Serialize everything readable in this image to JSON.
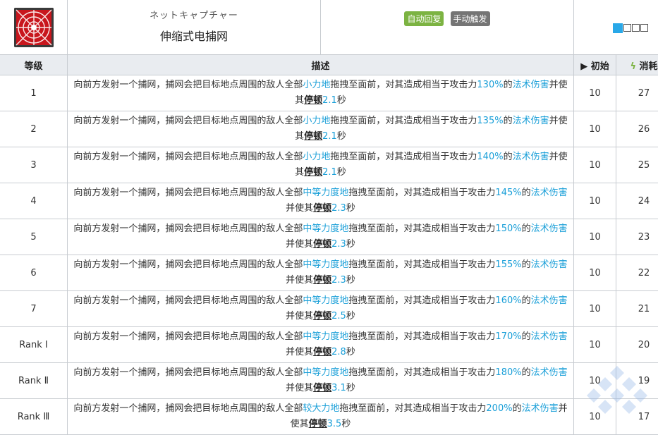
{
  "skill": {
    "name_jp": "ネットキャプチャー",
    "name_cn": "伸缩式电捕网",
    "tags": [
      "自动回复",
      "手动触发"
    ]
  },
  "headers": {
    "level": "等级",
    "description": "描述",
    "initial": "初始",
    "cost": "消耗"
  },
  "rows": [
    {
      "level": "1",
      "parts": [
        {
          "t": "向前方发射一个捕网，捕网会把目标地点周围的敌人全部"
        },
        {
          "t": "小力地",
          "c": "blue"
        },
        {
          "t": "拖拽至面前，对其造成相当于攻击力"
        },
        {
          "t": "130%",
          "c": "blue"
        },
        {
          "t": "的"
        },
        {
          "t": "法术伤害",
          "c": "blue"
        },
        {
          "t": "并使其"
        },
        {
          "t": "停顿",
          "c": "bold"
        },
        {
          "t": "2.1",
          "c": "blue"
        },
        {
          "t": "秒"
        }
      ],
      "initial": "10",
      "cost": "27"
    },
    {
      "level": "2",
      "parts": [
        {
          "t": "向前方发射一个捕网，捕网会把目标地点周围的敌人全部"
        },
        {
          "t": "小力地",
          "c": "blue"
        },
        {
          "t": "拖拽至面前，对其造成相当于攻击力"
        },
        {
          "t": "135%",
          "c": "blue"
        },
        {
          "t": "的"
        },
        {
          "t": "法术伤害",
          "c": "blue"
        },
        {
          "t": "并使其"
        },
        {
          "t": "停顿",
          "c": "bold"
        },
        {
          "t": "2.1",
          "c": "blue"
        },
        {
          "t": "秒"
        }
      ],
      "initial": "10",
      "cost": "26"
    },
    {
      "level": "3",
      "parts": [
        {
          "t": "向前方发射一个捕网，捕网会把目标地点周围的敌人全部"
        },
        {
          "t": "小力地",
          "c": "blue"
        },
        {
          "t": "拖拽至面前，对其造成相当于攻击力"
        },
        {
          "t": "140%",
          "c": "blue"
        },
        {
          "t": "的"
        },
        {
          "t": "法术伤害",
          "c": "blue"
        },
        {
          "t": "并使其"
        },
        {
          "t": "停顿",
          "c": "bold"
        },
        {
          "t": "2.1",
          "c": "blue"
        },
        {
          "t": "秒"
        }
      ],
      "initial": "10",
      "cost": "25"
    },
    {
      "level": "4",
      "parts": [
        {
          "t": "向前方发射一个捕网，捕网会把目标地点周围的敌人全部"
        },
        {
          "t": "中等力度地",
          "c": "blue"
        },
        {
          "t": "拖拽至面前，对其造成相当于攻击力"
        },
        {
          "t": "145%",
          "c": "blue"
        },
        {
          "t": "的"
        },
        {
          "t": "法术伤害",
          "c": "blue"
        },
        {
          "t": "并使其"
        },
        {
          "t": "停顿",
          "c": "bold"
        },
        {
          "t": "2.3",
          "c": "blue"
        },
        {
          "t": "秒"
        }
      ],
      "initial": "10",
      "cost": "24"
    },
    {
      "level": "5",
      "parts": [
        {
          "t": "向前方发射一个捕网，捕网会把目标地点周围的敌人全部"
        },
        {
          "t": "中等力度地",
          "c": "blue"
        },
        {
          "t": "拖拽至面前，对其造成相当于攻击力"
        },
        {
          "t": "150%",
          "c": "blue"
        },
        {
          "t": "的"
        },
        {
          "t": "法术伤害",
          "c": "blue"
        },
        {
          "t": "并使其"
        },
        {
          "t": "停顿",
          "c": "bold"
        },
        {
          "t": "2.3",
          "c": "blue"
        },
        {
          "t": "秒"
        }
      ],
      "initial": "10",
      "cost": "23"
    },
    {
      "level": "6",
      "parts": [
        {
          "t": "向前方发射一个捕网，捕网会把目标地点周围的敌人全部"
        },
        {
          "t": "中等力度地",
          "c": "blue"
        },
        {
          "t": "拖拽至面前，对其造成相当于攻击力"
        },
        {
          "t": "155%",
          "c": "blue"
        },
        {
          "t": "的"
        },
        {
          "t": "法术伤害",
          "c": "blue"
        },
        {
          "t": "并使其"
        },
        {
          "t": "停顿",
          "c": "bold"
        },
        {
          "t": "2.3",
          "c": "blue"
        },
        {
          "t": "秒"
        }
      ],
      "initial": "10",
      "cost": "22"
    },
    {
      "level": "7",
      "parts": [
        {
          "t": "向前方发射一个捕网，捕网会把目标地点周围的敌人全部"
        },
        {
          "t": "中等力度地",
          "c": "blue"
        },
        {
          "t": "拖拽至面前，对其造成相当于攻击力"
        },
        {
          "t": "160%",
          "c": "blue"
        },
        {
          "t": "的"
        },
        {
          "t": "法术伤害",
          "c": "blue"
        },
        {
          "t": "并使其"
        },
        {
          "t": "停顿",
          "c": "bold"
        },
        {
          "t": "2.5",
          "c": "blue"
        },
        {
          "t": "秒"
        }
      ],
      "initial": "10",
      "cost": "21"
    },
    {
      "level": "Rank Ⅰ",
      "parts": [
        {
          "t": "向前方发射一个捕网，捕网会把目标地点周围的敌人全部"
        },
        {
          "t": "中等力度地",
          "c": "blue"
        },
        {
          "t": "拖拽至面前，对其造成相当于攻击力"
        },
        {
          "t": "170%",
          "c": "blue"
        },
        {
          "t": "的"
        },
        {
          "t": "法术伤害",
          "c": "blue"
        },
        {
          "t": "并使其"
        },
        {
          "t": "停顿",
          "c": "bold"
        },
        {
          "t": "2.8",
          "c": "blue"
        },
        {
          "t": "秒"
        }
      ],
      "initial": "10",
      "cost": "20"
    },
    {
      "level": "Rank Ⅱ",
      "parts": [
        {
          "t": "向前方发射一个捕网，捕网会把目标地点周围的敌人全部"
        },
        {
          "t": "中等力度地",
          "c": "blue"
        },
        {
          "t": "拖拽至面前，对其造成相当于攻击力"
        },
        {
          "t": "180%",
          "c": "blue"
        },
        {
          "t": "的"
        },
        {
          "t": "法术伤害",
          "c": "blue"
        },
        {
          "t": "并使其"
        },
        {
          "t": "停顿",
          "c": "bold"
        },
        {
          "t": "3.1",
          "c": "blue"
        },
        {
          "t": "秒"
        }
      ],
      "initial": "10",
      "cost": "19"
    },
    {
      "level": "Rank Ⅲ",
      "parts": [
        {
          "t": "向前方发射一个捕网，捕网会把目标地点周围的敌人全部"
        },
        {
          "t": "较大力地",
          "c": "blue"
        },
        {
          "t": "拖拽至面前，对其造成相当于攻击力"
        },
        {
          "t": "200%",
          "c": "blue"
        },
        {
          "t": "的"
        },
        {
          "t": "法术伤害",
          "c": "blue"
        },
        {
          "t": "并使其"
        },
        {
          "t": "停顿",
          "c": "bold"
        },
        {
          "t": "3.5",
          "c": "blue"
        },
        {
          "t": "秒"
        }
      ],
      "initial": "10",
      "cost": "17"
    }
  ],
  "range_indicator": {
    "filled": 1,
    "total": 4
  },
  "colors": {
    "accent_blue": "#1a9fd8",
    "tag_green": "#7cb342",
    "tag_gray": "#757575",
    "header_bg": "#e9ecf0"
  },
  "icons": [
    "skill-net-icon",
    "play-icon",
    "bolt-icon"
  ]
}
